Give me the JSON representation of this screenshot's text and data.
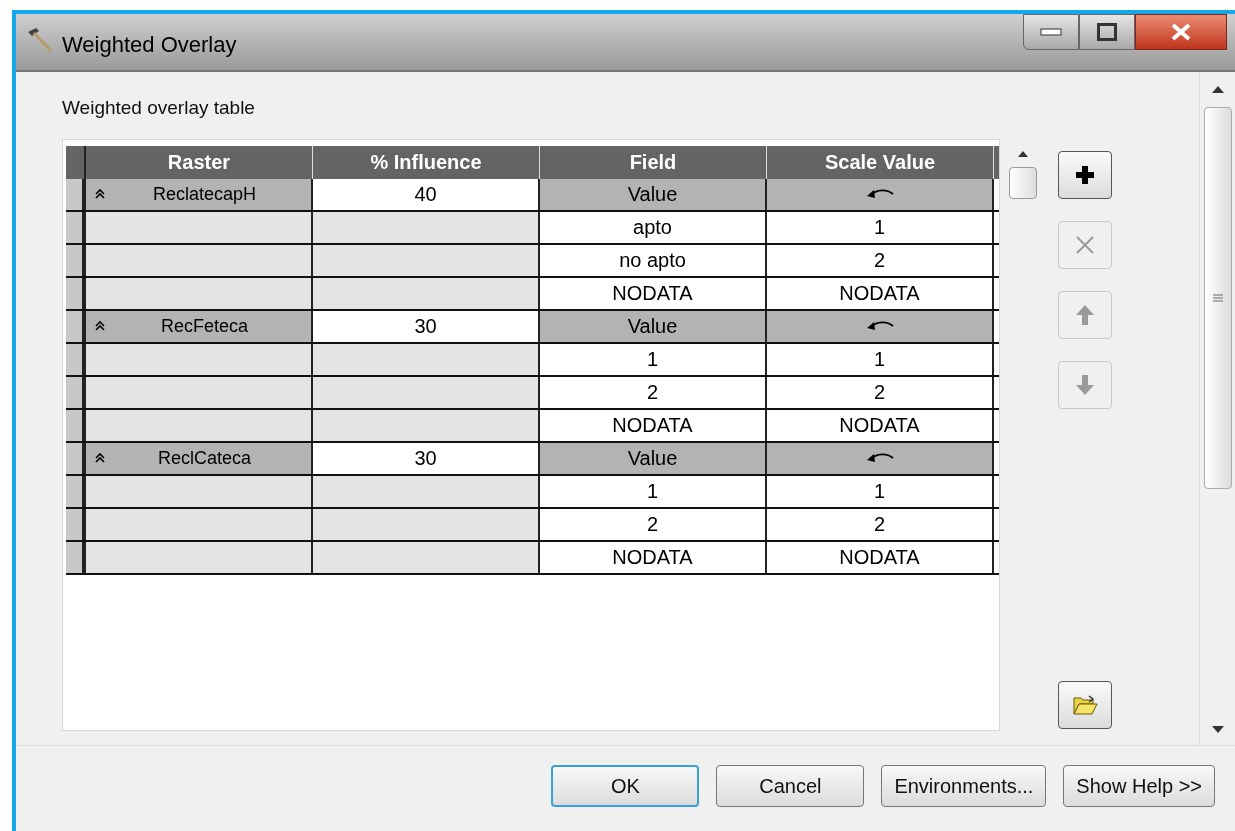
{
  "window": {
    "title": "Weighted Overlay"
  },
  "table_label": "Weighted overlay table",
  "table": {
    "columns": [
      "Raster",
      "% Influence",
      "Field",
      "Scale Value"
    ],
    "groups": [
      {
        "raster": "ReclatecapH",
        "influence": "40",
        "field": "Value",
        "expanded": true,
        "rows": [
          {
            "field": "apto",
            "scale": "1"
          },
          {
            "field": "no apto",
            "scale": "2"
          },
          {
            "field": "NODATA",
            "scale": "NODATA"
          }
        ]
      },
      {
        "raster": "RecFeteca",
        "influence": "30",
        "field": "Value",
        "expanded": true,
        "rows": [
          {
            "field": "1",
            "scale": "1"
          },
          {
            "field": "2",
            "scale": "2"
          },
          {
            "field": "NODATA",
            "scale": "NODATA"
          }
        ]
      },
      {
        "raster": "ReclCateca",
        "influence": "30",
        "field": "Value",
        "expanded": true,
        "rows": [
          {
            "field": "1",
            "scale": "1"
          },
          {
            "field": "2",
            "scale": "2"
          },
          {
            "field": "NODATA",
            "scale": "NODATA"
          }
        ]
      }
    ]
  },
  "side_buttons": [
    {
      "kind": "add",
      "disabled": false
    },
    {
      "kind": "remove",
      "disabled": true
    },
    {
      "kind": "move_up",
      "disabled": true
    },
    {
      "kind": "move_down",
      "disabled": true
    },
    {
      "kind": "open",
      "disabled": false
    }
  ],
  "buttons": [
    {
      "label": "OK",
      "default": true
    },
    {
      "label": "Cancel",
      "default": false
    },
    {
      "label": "Environments...",
      "default": false
    },
    {
      "label": "Show Help >>",
      "default": false
    }
  ]
}
